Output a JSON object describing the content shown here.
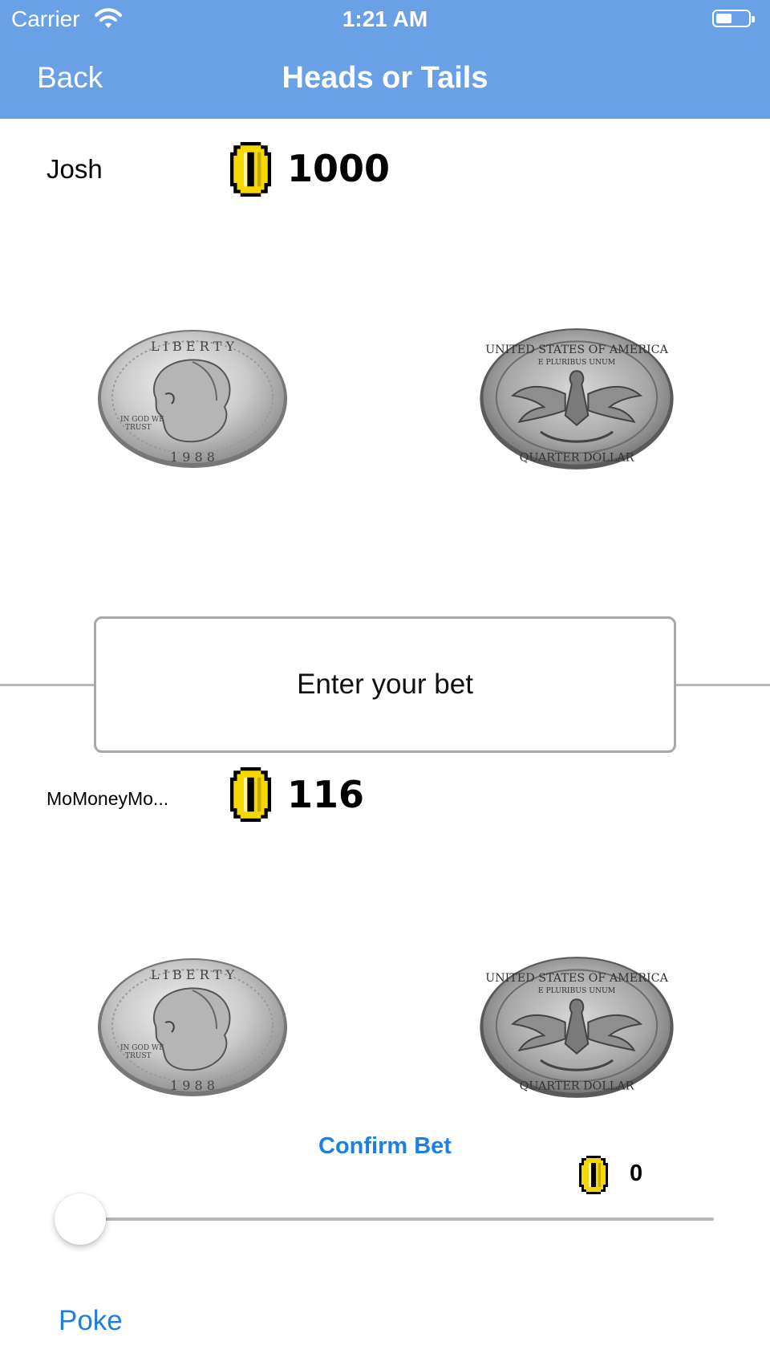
{
  "status_bar": {
    "carrier": "Carrier",
    "time": "1:21 AM",
    "battery_level": 0.5
  },
  "nav": {
    "back_label": "Back",
    "title": "Heads or Tails"
  },
  "player1": {
    "name": "Josh",
    "balance": "1000"
  },
  "bet": {
    "placeholder": "Enter your bet"
  },
  "player2": {
    "name": "MoMoneyMo...",
    "balance": "116"
  },
  "actions": {
    "confirm_label": "Confirm Bet",
    "bet_amount": "0",
    "slider_value": 0,
    "poke_label": "Poke"
  },
  "icons": [
    "wifi-icon",
    "battery-icon",
    "gold-coin-icon",
    "quarter-heads-icon",
    "quarter-tails-icon"
  ],
  "colors": {
    "nav_bar": "#6aa1e6",
    "link_blue": "#1e7fe0",
    "gold": "#f5d800"
  }
}
